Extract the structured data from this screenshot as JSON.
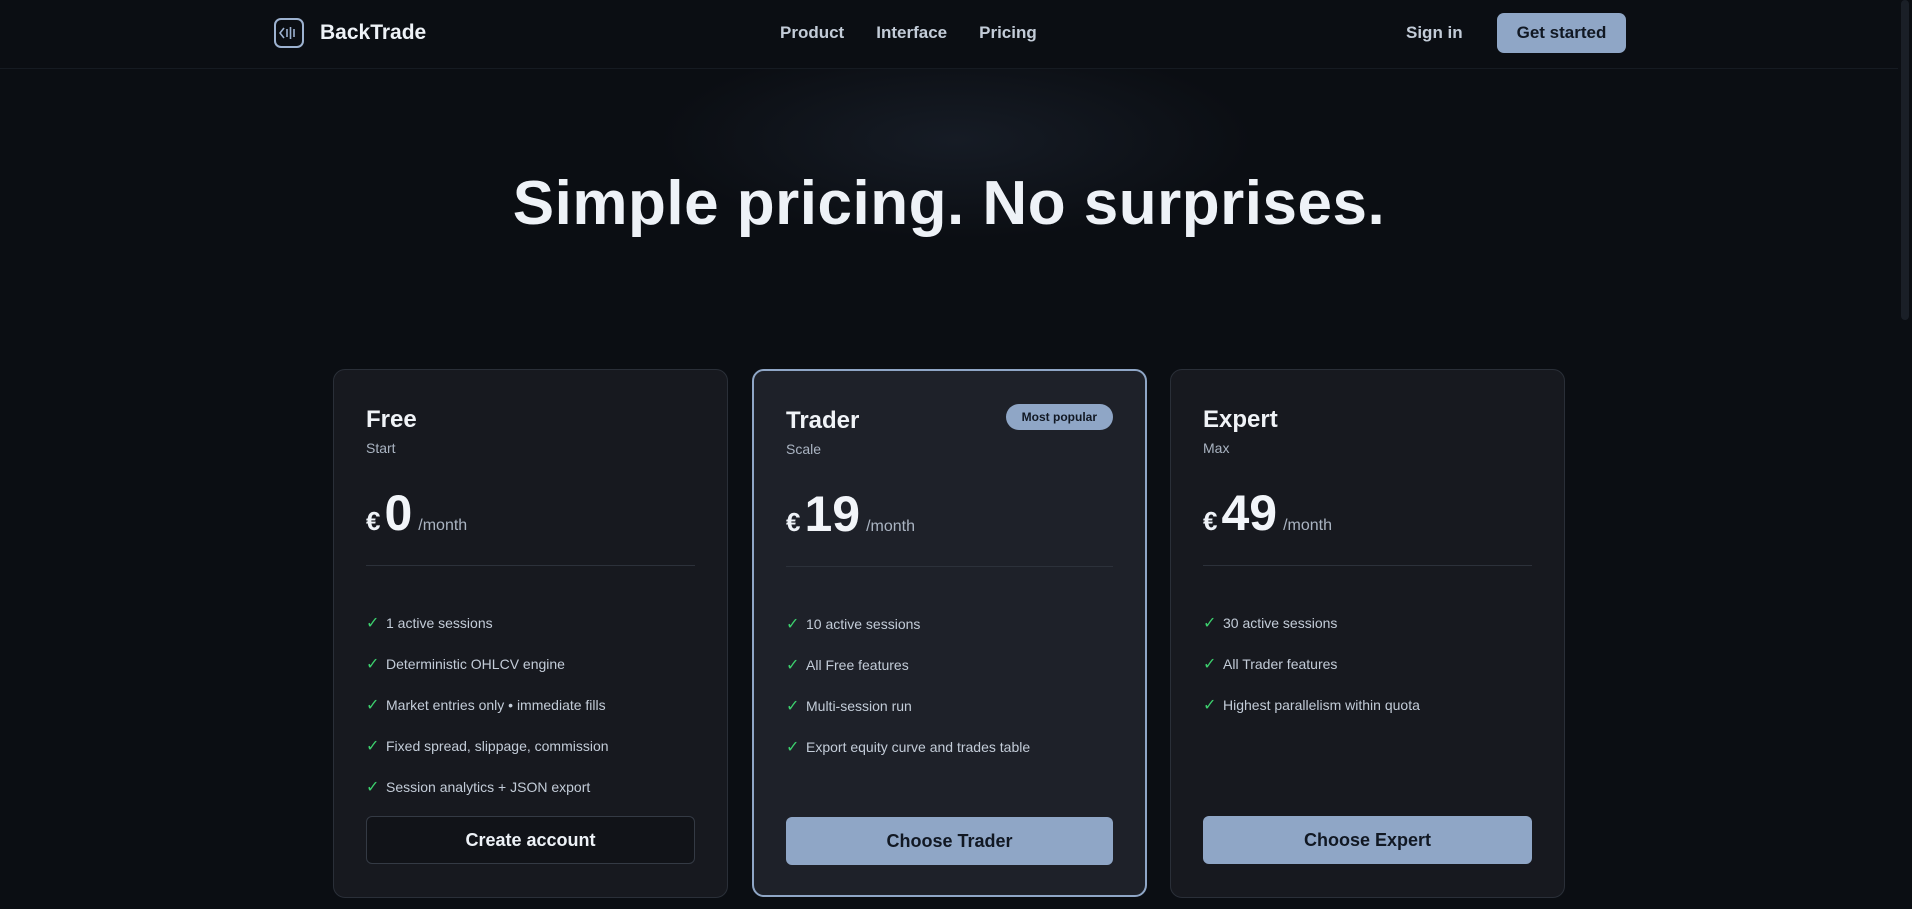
{
  "nav": {
    "brand": "BackTrade",
    "links": [
      "Product",
      "Interface",
      "Pricing"
    ],
    "signin": "Sign in",
    "cta": "Get started"
  },
  "hero": {
    "headline": "Simple pricing. No surprises."
  },
  "plans": [
    {
      "name": "Free",
      "tagline": "Start",
      "currency": "€",
      "price": "0",
      "period": "/month",
      "features": [
        "1 active sessions",
        "Deterministic OHLCV engine",
        "Market entries only • immediate fills",
        "Fixed spread, slippage, commission",
        "Session analytics + JSON export"
      ],
      "cta": "Create account"
    },
    {
      "name": "Trader",
      "tagline": "Scale",
      "badge": "Most popular",
      "currency": "€",
      "price": "19",
      "period": "/month",
      "features": [
        "10 active sessions",
        "All Free features",
        "Multi-session run",
        "Export equity curve and trades table"
      ],
      "cta": "Choose Trader"
    },
    {
      "name": "Expert",
      "tagline": "Max",
      "currency": "€",
      "price": "49",
      "period": "/month",
      "features": [
        "30 active sessions",
        "All Trader features",
        "Highest parallelism within quota"
      ],
      "cta": "Choose Expert"
    }
  ],
  "icons": {
    "check": "checkmark-icon",
    "logo": "backtrade-logo-icon"
  },
  "colors": {
    "accent": "#8fa6c6",
    "check": "#3ccf6d",
    "background": "#0b0e13"
  }
}
